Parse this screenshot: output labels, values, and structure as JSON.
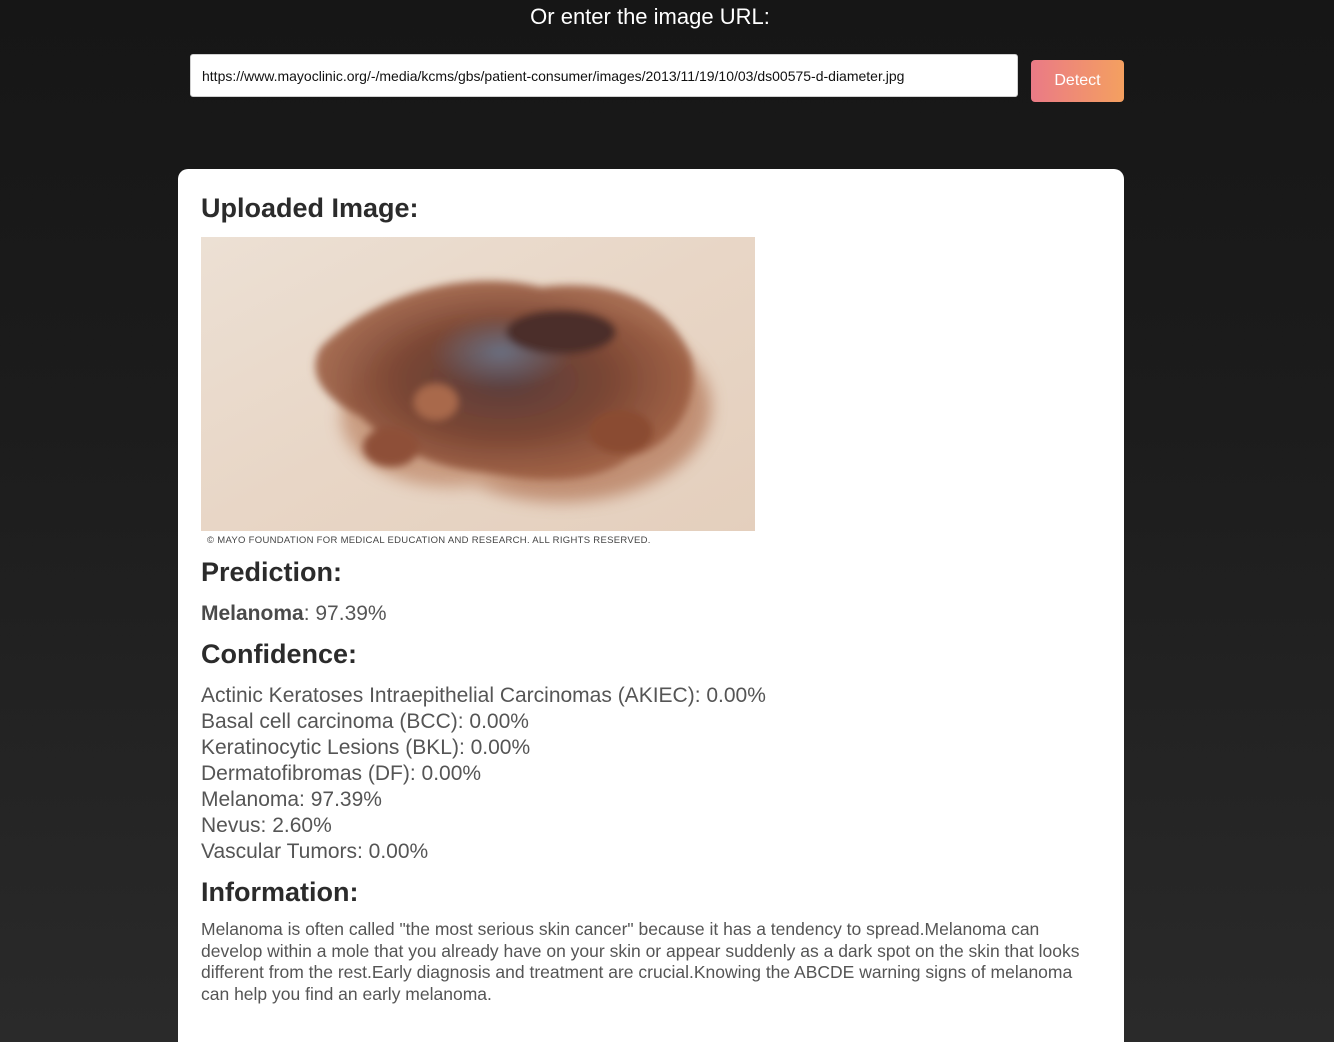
{
  "url_section": {
    "heading": "Or enter the image URL:",
    "input_value": "https://www.mayoclinic.org/-/media/kcms/gbs/patient-consumer/images/2013/11/19/10/03/ds00575-d-diameter.jpg",
    "detect_label": "Detect"
  },
  "result": {
    "uploaded_title": "Uploaded Image:",
    "image_credit": "© MAYO FOUNDATION FOR MEDICAL EDUCATION AND RESEARCH. ALL RIGHTS RESERVED.",
    "prediction_title": "Prediction:",
    "prediction_class": "Melanoma",
    "prediction_value": ": 97.39%",
    "confidence_title": "Confidence:",
    "confidence": [
      "Actinic Keratoses Intraepithelial Carcinomas (AKIEC): 0.00%",
      "Basal cell carcinoma (BCC): 0.00%",
      "Keratinocytic Lesions (BKL): 0.00%",
      "Dermatofibromas (DF): 0.00%",
      "Melanoma: 97.39%",
      "Nevus: 2.60%",
      "Vascular Tumors: 0.00%"
    ],
    "information_title": "Information:",
    "information_text": "Melanoma is often called \"the most serious skin cancer\" because it has a tendency to spread.Melanoma can develop within a mole that you already have on your skin or appear suddenly as a dark spot on the skin that looks different from the rest.Early diagnosis and treatment are crucial.Knowing the ABCDE warning signs of melanoma can help you find an early melanoma."
  },
  "colors": {
    "background": "#1c1c1c",
    "button_gradient_start": "#ea7a86",
    "button_gradient_end": "#f4a060",
    "card": "#ffffff"
  }
}
